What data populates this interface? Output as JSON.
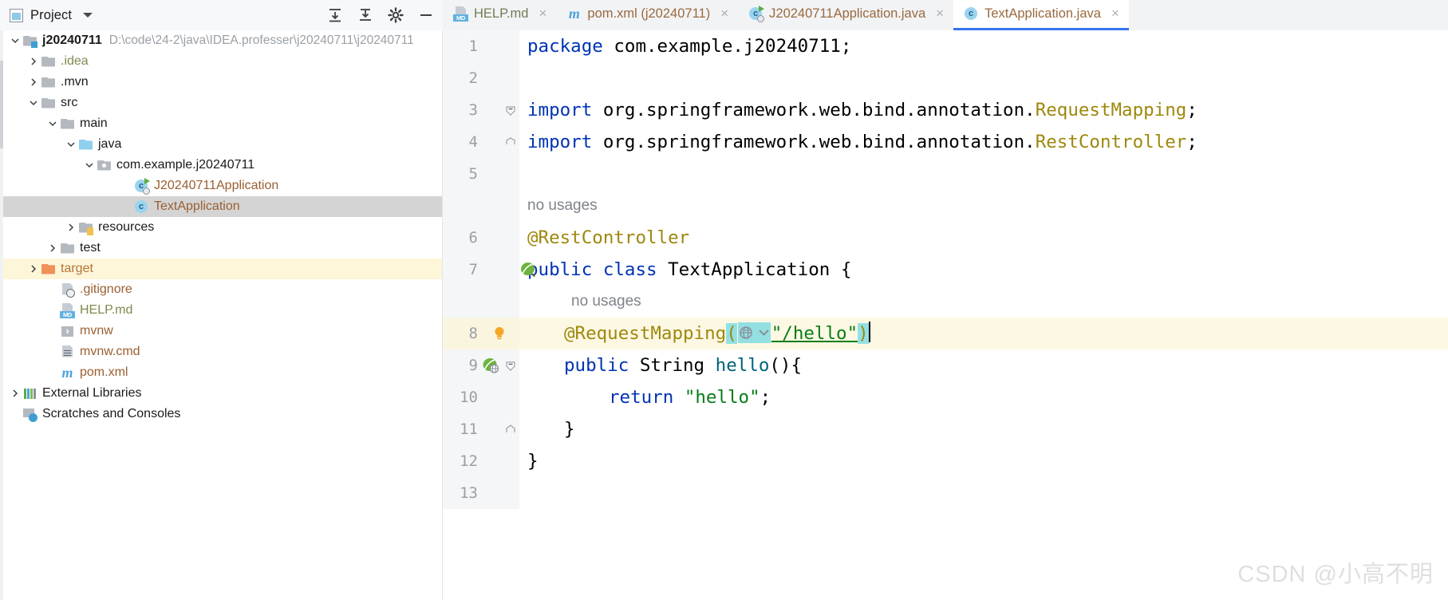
{
  "window": {
    "project_tool_label": "Project",
    "collapse_all_icon": "collapse-all-icon",
    "expand_all_icon": "expand-all-icon",
    "settings_icon": "gear-icon",
    "hide_icon": "minimize-icon",
    "dropdown_icon": "chevron-down-icon"
  },
  "tabs": [
    {
      "label": "HELP.md",
      "icon": "markdown-file-icon",
      "active": false,
      "close": "×"
    },
    {
      "label": "pom.xml (j20240711)",
      "icon": "maven-file-icon",
      "active": false,
      "close": "×"
    },
    {
      "label": "J20240711Application.java",
      "icon": "java-class-runnable-icon",
      "active": false,
      "close": "×"
    },
    {
      "label": "TextApplication.java",
      "icon": "java-class-icon",
      "active": true,
      "close": "×"
    }
  ],
  "tree": [
    {
      "label": "j20240711",
      "sub": "D:\\code\\24-2\\java\\IDEA.professer\\j20240711\\j20240711",
      "indent": 0,
      "twisty": "down",
      "icon": "module-folder-icon",
      "style": "bold"
    },
    {
      "label": ".idea",
      "sub": "",
      "indent": 1,
      "twisty": "right",
      "icon": "folder-icon",
      "style": "olive"
    },
    {
      "label": ".mvn",
      "sub": "",
      "indent": 1,
      "twisty": "right",
      "icon": "folder-icon",
      "style": "plain"
    },
    {
      "label": "src",
      "sub": "",
      "indent": 1,
      "twisty": "down",
      "icon": "folder-icon",
      "style": "plain"
    },
    {
      "label": "main",
      "sub": "",
      "indent": 2,
      "twisty": "down",
      "icon": "folder-icon",
      "style": "plain"
    },
    {
      "label": "java",
      "sub": "",
      "indent": 3,
      "twisty": "down",
      "icon": "source-folder-icon",
      "style": "plain"
    },
    {
      "label": "com.example.j20240711",
      "sub": "",
      "indent": 4,
      "twisty": "down",
      "icon": "package-icon",
      "style": "plain"
    },
    {
      "label": "J20240711Application",
      "sub": "",
      "indent": 6,
      "twisty": "none",
      "icon": "java-class-runnable-icon",
      "style": "brown"
    },
    {
      "label": "TextApplication",
      "sub": "",
      "indent": 6,
      "twisty": "none",
      "icon": "java-class-icon",
      "style": "brown",
      "state": "selected"
    },
    {
      "label": "resources",
      "sub": "",
      "indent": 3,
      "twisty": "right",
      "icon": "resources-folder-icon",
      "style": "plain"
    },
    {
      "label": "test",
      "sub": "",
      "indent": 2,
      "twisty": "right",
      "icon": "folder-icon",
      "style": "plain"
    },
    {
      "label": "target",
      "sub": "",
      "indent": 1,
      "twisty": "right",
      "icon": "excluded-folder-icon",
      "style": "orange",
      "state": "highlight"
    },
    {
      "label": ".gitignore",
      "sub": "",
      "indent": 2,
      "twisty": "none",
      "icon": "gitignore-file-icon",
      "style": "brown"
    },
    {
      "label": "HELP.md",
      "sub": "",
      "indent": 2,
      "twisty": "none",
      "icon": "markdown-file-icon",
      "style": "olive"
    },
    {
      "label": "mvnw",
      "sub": "",
      "indent": 2,
      "twisty": "none",
      "icon": "shell-file-icon",
      "style": "brown"
    },
    {
      "label": "mvnw.cmd",
      "sub": "",
      "indent": 2,
      "twisty": "none",
      "icon": "cmd-file-icon",
      "style": "brown"
    },
    {
      "label": "pom.xml",
      "sub": "",
      "indent": 2,
      "twisty": "none",
      "icon": "maven-file-icon",
      "style": "brown"
    },
    {
      "label": "External Libraries",
      "sub": "",
      "indent": 0,
      "twisty": "right",
      "icon": "libraries-icon",
      "style": "plain"
    },
    {
      "label": "Scratches and Consoles",
      "sub": "",
      "indent": 0,
      "twisty": "none",
      "icon": "scratches-icon",
      "style": "plain"
    }
  ],
  "code": {
    "line_numbers": [
      "1",
      "2",
      "3",
      "4",
      "5",
      "6",
      "7",
      "8",
      "9",
      "10",
      "11",
      "12",
      "13"
    ],
    "inlay_hint": "no usages",
    "line1": {
      "kw": "package",
      "rest": " com.example.j20240711;"
    },
    "line3": {
      "kw": "import",
      "pkg": " org.springframework.web.bind.annotation.",
      "cls": "RequestMapping",
      "end": ";"
    },
    "line4": {
      "kw": "import",
      "pkg": " org.springframework.web.bind.annotation.",
      "cls": "RestController",
      "end": ";"
    },
    "line6": {
      "anno": "@RestController"
    },
    "line7": {
      "kw1": "public",
      "kw2": "class",
      "name": "TextApplication",
      "brace": "{"
    },
    "line8": {
      "anno": "@RequestMapping",
      "paren_open": "(",
      "value": "\"/hello\"",
      "paren_close": ")",
      "hint_icon": "web-mapping-globe-icon"
    },
    "line9": {
      "kw1": "public",
      "type": "String",
      "method": "hello",
      "parens": "()",
      "brace": "{"
    },
    "line10": {
      "kw": "return",
      "str": "\"hello\"",
      "end": ";"
    },
    "line11": {
      "brace": "}"
    },
    "line12": {
      "brace": "}"
    },
    "gutter_icons": {
      "line7": "spring-bean-icon",
      "line8": "intention-bulb-icon",
      "line9": "spring-request-mapping-icon"
    }
  },
  "watermark": "CSDN @小高不明",
  "colors": {
    "accent": "#3574f0",
    "keyword": "#0033b3",
    "annotation": "#9e880d",
    "string": "#067d17",
    "method": "#00627a",
    "selection": "#d4d4d4",
    "highlight_row": "#fdf8e4",
    "brace_match": "#93e0e3"
  }
}
